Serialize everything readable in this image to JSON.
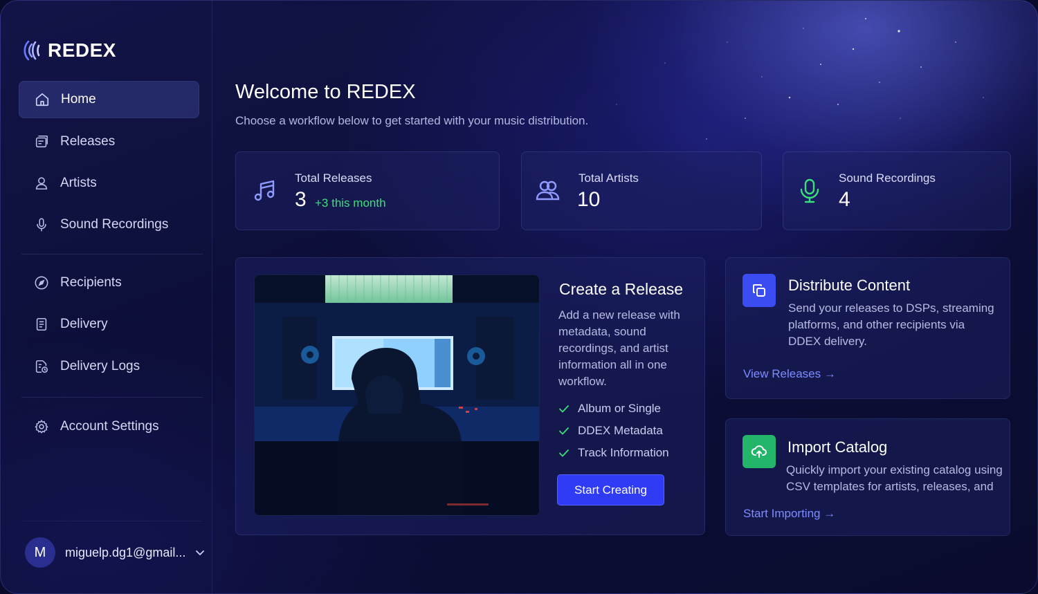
{
  "brand": {
    "name": "REDEX"
  },
  "sidebar": {
    "items": [
      {
        "label": "Home",
        "icon": "home-icon",
        "active": true
      },
      {
        "label": "Releases",
        "icon": "releases-icon"
      },
      {
        "label": "Artists",
        "icon": "user-icon"
      },
      {
        "label": "Sound Recordings",
        "icon": "microphone-icon"
      },
      {
        "label": "Recipients",
        "icon": "compass-icon"
      },
      {
        "label": "Delivery",
        "icon": "document-icon"
      },
      {
        "label": "Delivery Logs",
        "icon": "log-icon"
      },
      {
        "label": "Account Settings",
        "icon": "gear-icon"
      }
    ],
    "user": {
      "initial": "M",
      "email": "miguelp.dg1@gmail..."
    }
  },
  "header": {
    "title": "Welcome to REDEX",
    "subtitle": "Choose a workflow below to get started with your music distribution."
  },
  "stats": [
    {
      "label": "Total Releases",
      "value": "3",
      "trend": "+3 this month",
      "icon": "music-note-icon",
      "color": "#8f9bff"
    },
    {
      "label": "Total Artists",
      "value": "10",
      "icon": "users-icon",
      "color": "#8f9bff"
    },
    {
      "label": "Sound Recordings",
      "value": "4",
      "icon": "microphone-icon",
      "color": "#3be07a"
    }
  ],
  "create_release": {
    "title": "Create a Release",
    "description": "Add a new release with metadata, sound recordings, and artist information all in one workflow.",
    "checks": [
      "Album or Single",
      "DDEX Metadata",
      "Track Information"
    ],
    "button": "Start Creating"
  },
  "distribute": {
    "title": "Distribute Content",
    "description": "Send your releases to DSPs, streaming platforms, and other recipients via DDEX delivery.",
    "link": "View Releases →",
    "icon_color": "#3a4cf2"
  },
  "import_catalog": {
    "title": "Import Catalog",
    "description": "Quickly import your existing catalog using CSV templates for artists, releases, and",
    "link": "Start Importing →",
    "icon_color": "#23b56a"
  },
  "colors": {
    "accent": "#2f3bf5",
    "success": "#3be07a",
    "link": "#7d8cff"
  }
}
